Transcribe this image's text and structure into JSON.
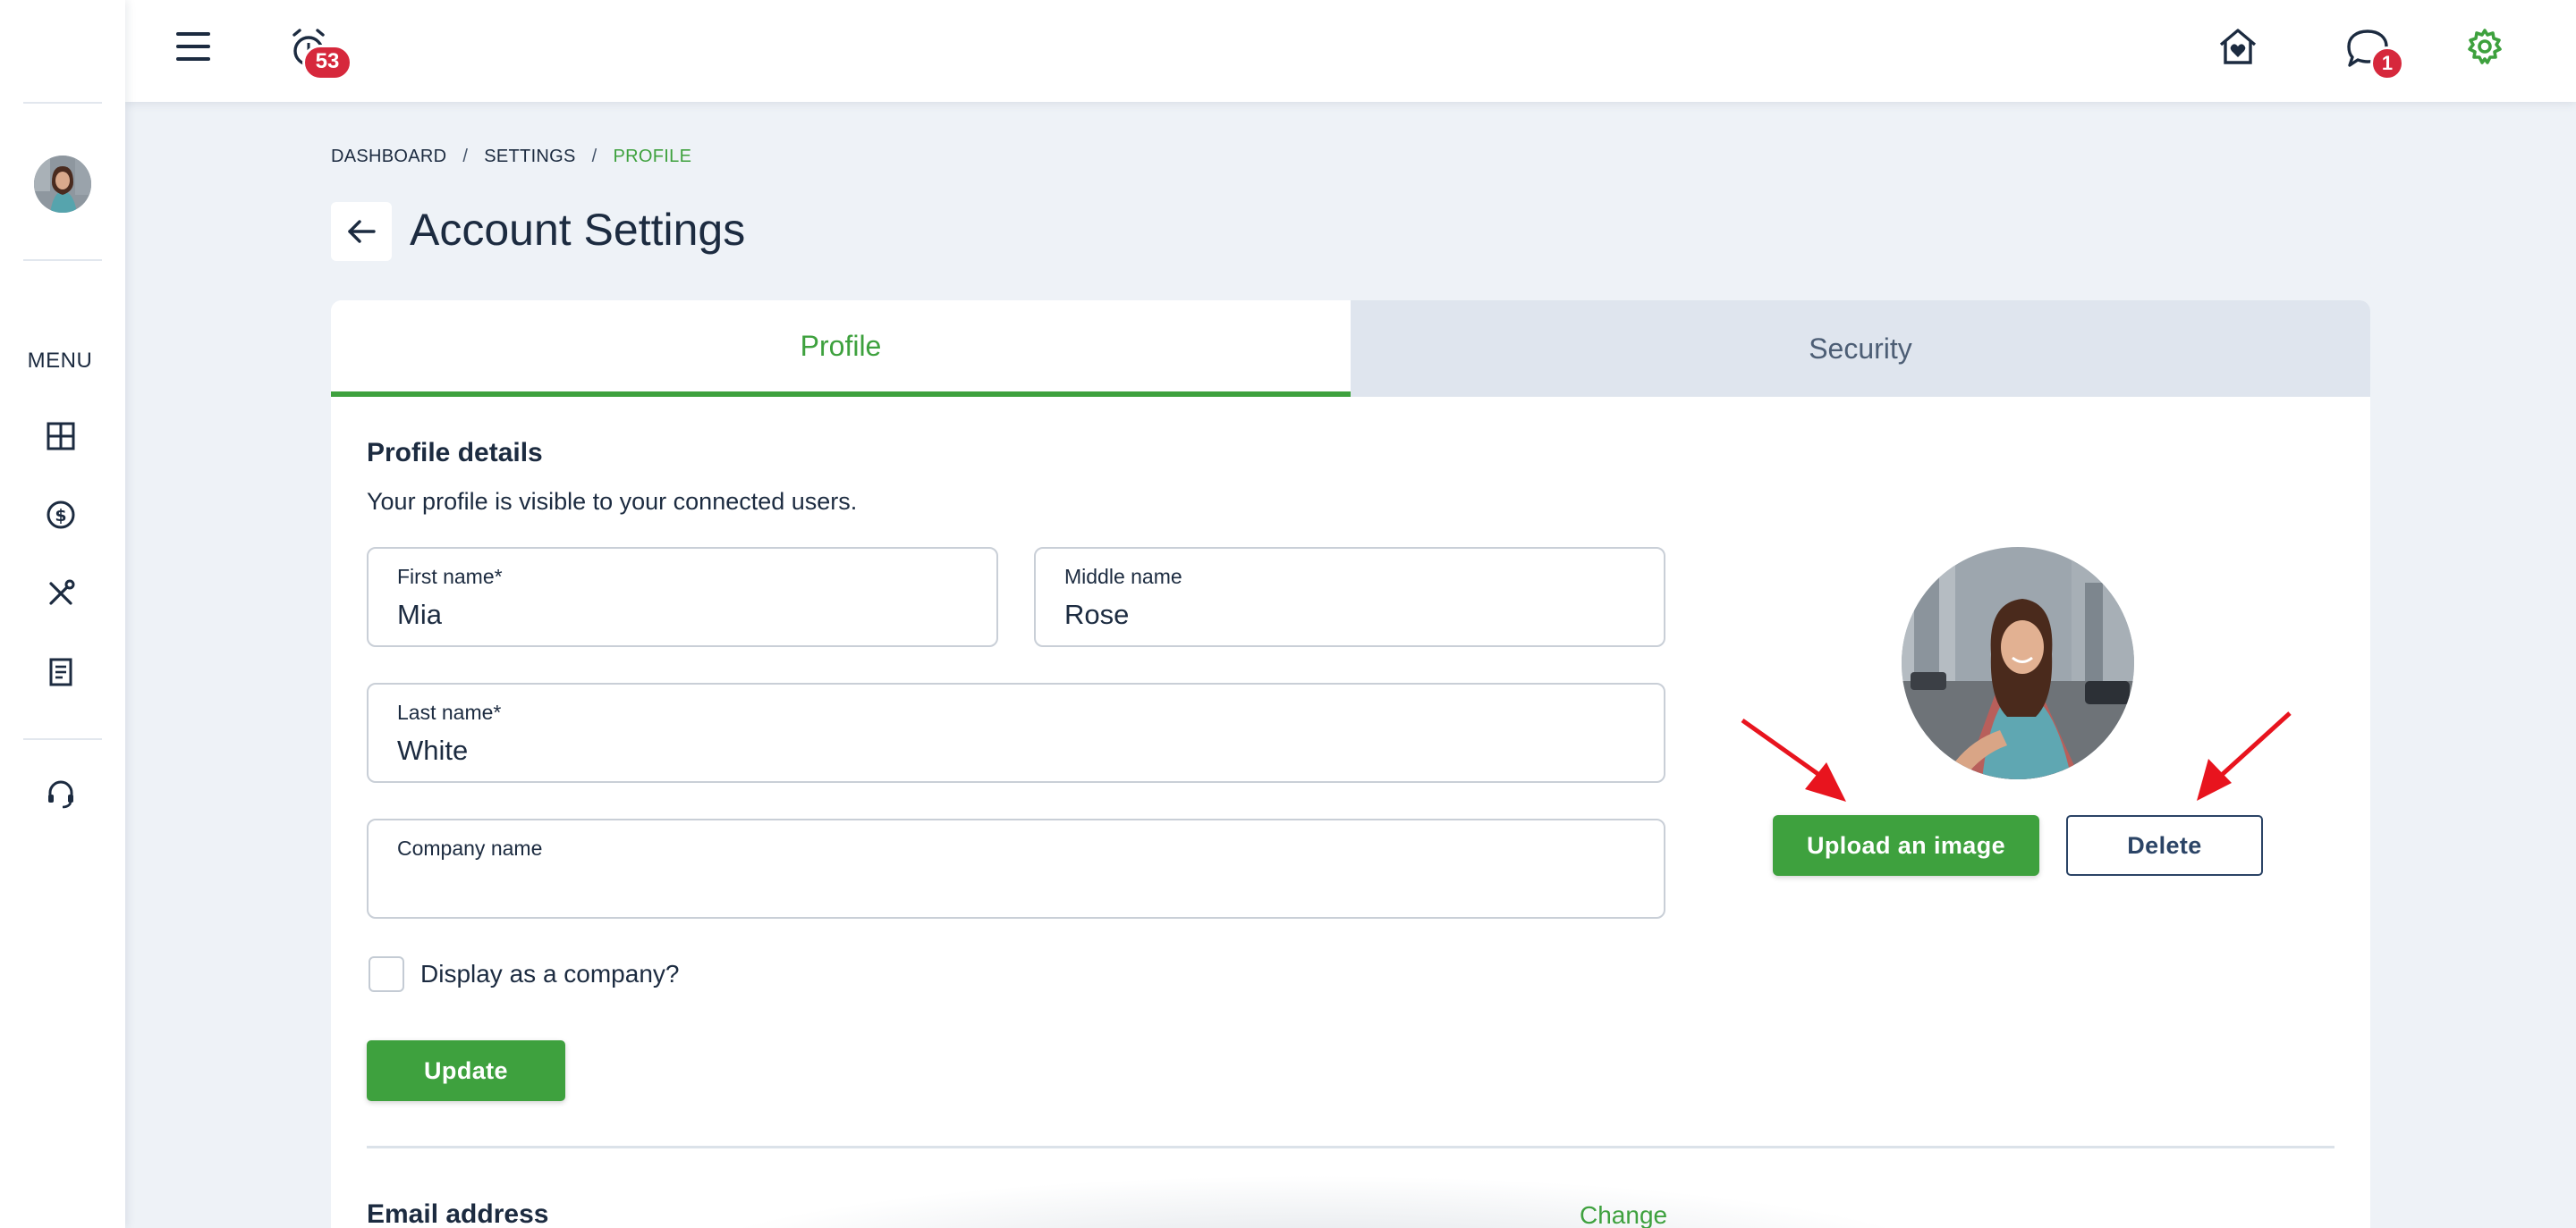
{
  "colors": {
    "accent": "#3ea13e",
    "badge": "#d6283c",
    "navy": "#1c2b40",
    "annotation_arrow": "#e8141e"
  },
  "topbar": {
    "menu_icon": "hamburger-icon",
    "alarm_icon": "alarm-clock-icon",
    "alarm_badge": "53",
    "home_icon": "home-heart-icon",
    "chat_icon": "chat-bubble-icon",
    "chat_badge": "1",
    "settings_icon": "gear-icon"
  },
  "sidebar": {
    "menu_label": "MENU",
    "items": [
      {
        "name": "dashboard",
        "icon": "dashboard-grid-icon"
      },
      {
        "name": "finance",
        "icon": "dollar-circle-icon"
      },
      {
        "name": "tools",
        "icon": "wrench-screwdriver-icon"
      },
      {
        "name": "documents",
        "icon": "document-icon"
      },
      {
        "name": "support",
        "icon": "headset-icon"
      }
    ]
  },
  "breadcrumb": {
    "items": [
      "DASHBOARD",
      "SETTINGS",
      "PROFILE"
    ],
    "separator": "/"
  },
  "page": {
    "title": "Account Settings"
  },
  "tabs": [
    {
      "label": "Profile",
      "active": true
    },
    {
      "label": "Security",
      "active": false
    }
  ],
  "profile": {
    "section_title": "Profile details",
    "section_desc": "Your profile is visible to your connected users.",
    "fields": {
      "first_name": {
        "label": "First name*",
        "value": "Mia"
      },
      "middle_name": {
        "label": "Middle name",
        "value": "Rose"
      },
      "last_name": {
        "label": "Last name*",
        "value": "White"
      },
      "company_name": {
        "label": "Company name",
        "value": ""
      }
    },
    "display_company": {
      "label": "Display as a company?",
      "checked": false
    },
    "update_label": "Update",
    "upload_label": "Upload an image",
    "delete_label": "Delete"
  },
  "email": {
    "section_title": "Email address",
    "change_label": "Change"
  }
}
